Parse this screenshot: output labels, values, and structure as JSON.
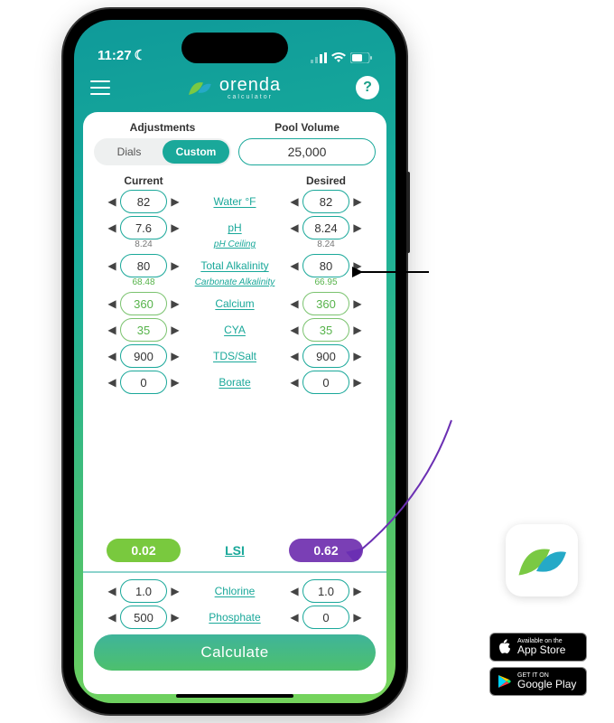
{
  "status": {
    "time": "11:27",
    "moon": "☾"
  },
  "appbar": {
    "brand": "orenda",
    "sub": "calculator",
    "help": "?"
  },
  "top": {
    "adjustments_label": "Adjustments",
    "dials": "Dials",
    "custom": "Custom",
    "pool_volume_label": "Pool Volume",
    "pool_volume": "25,000"
  },
  "headers": {
    "current": "Current",
    "desired": "Desired"
  },
  "params": [
    {
      "name": "Water °F",
      "sublabel": "",
      "cur": "82",
      "des": "82",
      "green": false
    },
    {
      "name": "pH",
      "sublabel": "pH Ceiling",
      "cur": "7.6",
      "des": "8.24",
      "subcur": "8.24",
      "subdes": "8.24",
      "green": false
    },
    {
      "name": "Total Alkalinity",
      "sublabel": "Carbonate Alkalinity",
      "cur": "80",
      "des": "80",
      "subcur": "68.48",
      "subdes": "66.95",
      "green": false,
      "subgreen": true
    },
    {
      "name": "Calcium",
      "sublabel": "",
      "cur": "360",
      "des": "360",
      "green": true
    },
    {
      "name": "CYA",
      "sublabel": "",
      "cur": "35",
      "des": "35",
      "green": true
    },
    {
      "name": "TDS/Salt",
      "sublabel": "",
      "cur": "900",
      "des": "900",
      "green": false
    },
    {
      "name": "Borate",
      "sublabel": "",
      "cur": "0",
      "des": "0",
      "green": false
    }
  ],
  "lsi": {
    "label": "LSI",
    "cur": "0.02",
    "des": "0.62"
  },
  "below": [
    {
      "name": "Chlorine",
      "cur": "1.0",
      "des": "1.0"
    },
    {
      "name": "Phosphate",
      "cur": "500",
      "des": "0"
    }
  ],
  "calculate": "Calculate",
  "stores": {
    "apple_small": "Available on the",
    "apple": "App Store",
    "google_small": "GET IT ON",
    "google": "Google Play"
  }
}
